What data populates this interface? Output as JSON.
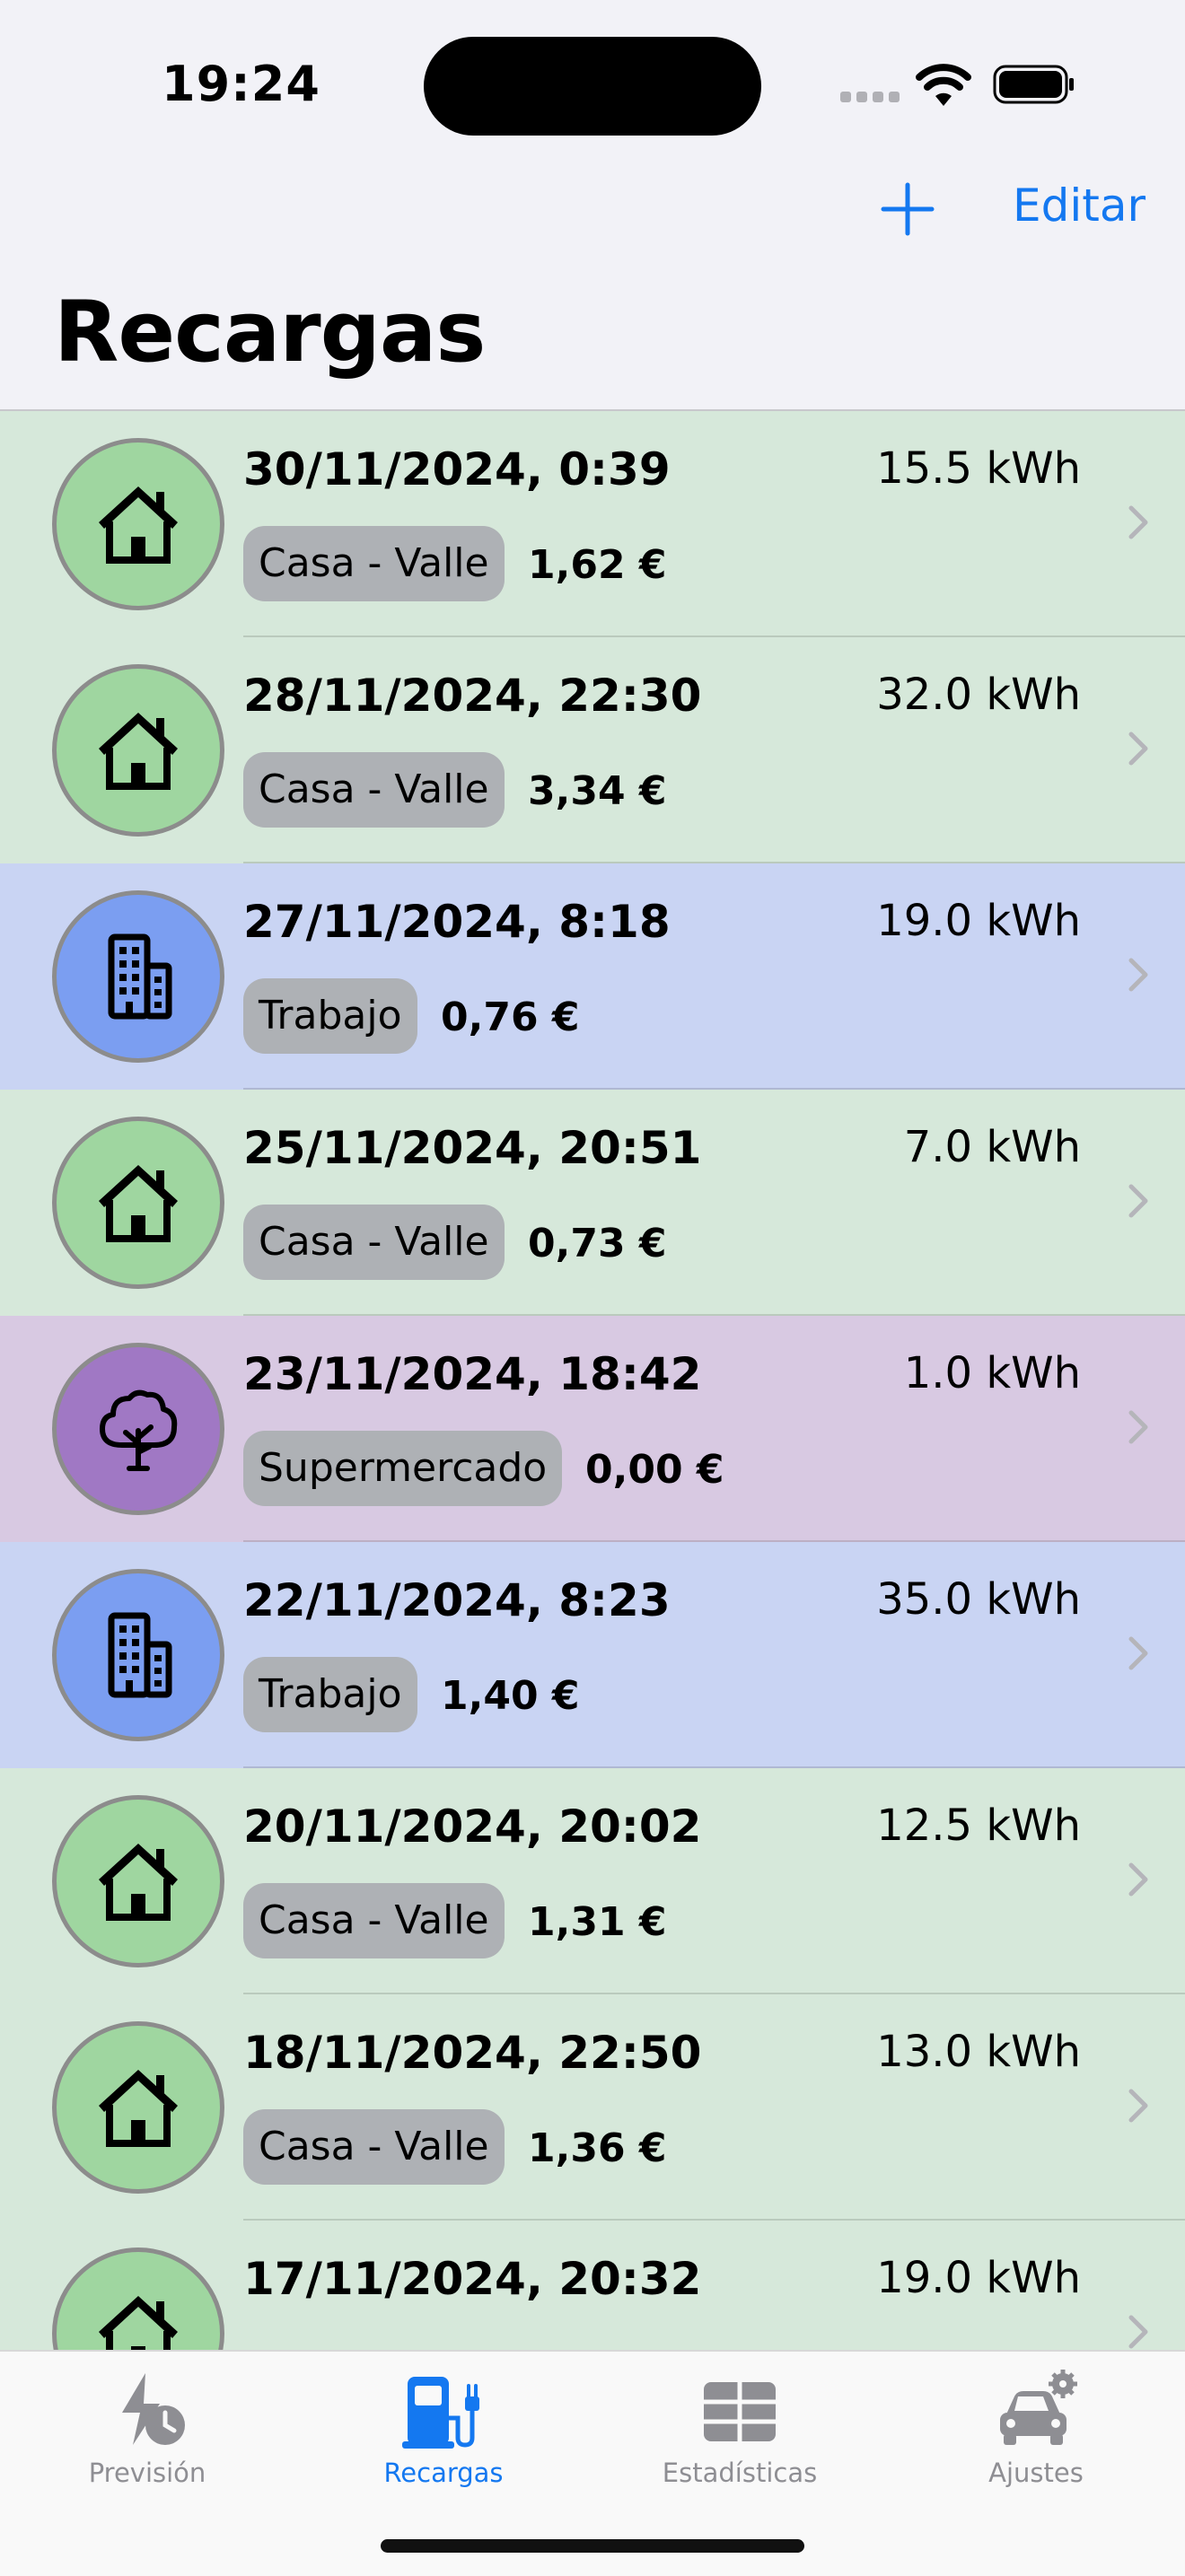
{
  "status_bar": {
    "time": "19:24"
  },
  "nav": {
    "edit_label": "Editar",
    "add_icon": "plus-icon"
  },
  "page": {
    "title": "Recargas"
  },
  "colors": {
    "accent": "#1478F0",
    "home_bg": "#D6E8DA",
    "home_circle": "#9FD6A0",
    "work_bg": "#C9D4F3",
    "work_circle": "#7B9EF1",
    "tree_bg": "#D8C9E2",
    "tree_circle": "#A078C4"
  },
  "charges": [
    {
      "date": "30/11/2024, 0:39",
      "energy": "15.5 kWh",
      "location": "Casa - Valle",
      "cost": "1,62 €",
      "icon": "house-icon",
      "type": "home"
    },
    {
      "date": "28/11/2024, 22:30",
      "energy": "32.0 kWh",
      "location": "Casa - Valle",
      "cost": "3,34 €",
      "icon": "house-icon",
      "type": "home"
    },
    {
      "date": "27/11/2024, 8:18",
      "energy": "19.0 kWh",
      "location": "Trabajo",
      "cost": "0,76 €",
      "icon": "building-icon",
      "type": "work"
    },
    {
      "date": "25/11/2024, 20:51",
      "energy": "7.0 kWh",
      "location": "Casa - Valle",
      "cost": "0,73 €",
      "icon": "house-icon",
      "type": "home"
    },
    {
      "date": "23/11/2024, 18:42",
      "energy": "1.0 kWh",
      "location": "Supermercado",
      "cost": "0,00 €",
      "icon": "tree-icon",
      "type": "tree"
    },
    {
      "date": "22/11/2024, 8:23",
      "energy": "35.0 kWh",
      "location": "Trabajo",
      "cost": "1,40 €",
      "icon": "building-icon",
      "type": "work"
    },
    {
      "date": "20/11/2024, 20:02",
      "energy": "12.5 kWh",
      "location": "Casa - Valle",
      "cost": "1,31 €",
      "icon": "house-icon",
      "type": "home"
    },
    {
      "date": "18/11/2024, 22:50",
      "energy": "13.0 kWh",
      "location": "Casa - Valle",
      "cost": "1,36 €",
      "icon": "house-icon",
      "type": "home"
    },
    {
      "date": "17/11/2024, 20:32",
      "energy": "19.0 kWh",
      "location": "",
      "cost": "",
      "icon": "house-icon",
      "type": "home"
    }
  ],
  "tab_bar": {
    "active": 1,
    "tabs": [
      {
        "label": "Previsión",
        "icon": "bolt-clock-icon"
      },
      {
        "label": "Recargas",
        "icon": "fuel-pump-plug-icon"
      },
      {
        "label": "Estadísticas",
        "icon": "table-icon"
      },
      {
        "label": "Ajustes",
        "icon": "car-gear-icon"
      }
    ]
  }
}
